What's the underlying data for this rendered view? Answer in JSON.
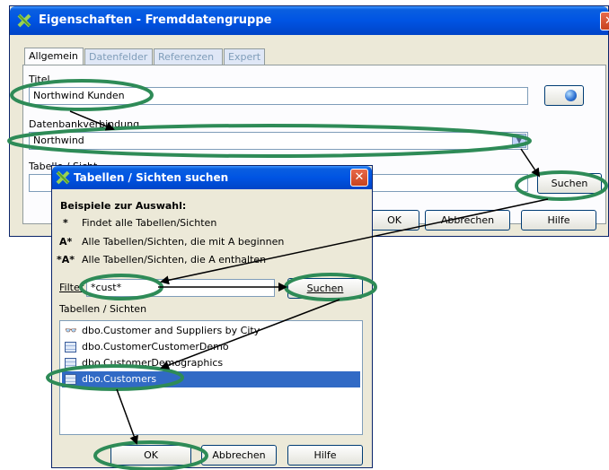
{
  "main_dialog": {
    "title": "Eigenschaften - Fremddatengruppe",
    "tabs": [
      {
        "label": "Allgemein",
        "active": true
      },
      {
        "label": "Datenfelder",
        "active": false
      },
      {
        "label": "Referenzen",
        "active": false
      },
      {
        "label": "Expert",
        "active": false
      }
    ],
    "titel_label": "Titel",
    "titel_value": "Northwind Kunden",
    "db_label": "Datenbankverbindung",
    "db_value": "Northwind",
    "table_label": "Tabelle / Sicht",
    "table_value": "",
    "suchen_label": "Suchen",
    "ok_label": "OK",
    "abbrechen_label": "Abbrechen",
    "hilfe_label": "Hilfe"
  },
  "search_dialog": {
    "title": "Tabellen / Sichten suchen",
    "examples_heading": "Beispiele zur Auswahl:",
    "examples": [
      {
        "symbol": "*",
        "text": "Findet alle Tabellen/Sichten"
      },
      {
        "symbol": "A*",
        "text": "Alle Tabellen/Sichten, die mit A beginnen"
      },
      {
        "symbol": "*A*",
        "text": "Alle Tabellen/Sichten, die A enthalten"
      }
    ],
    "filter_label": "Filter",
    "filter_value": "*cust*",
    "suchen_label": "Suchen",
    "list_label": "Tabellen / Sichten",
    "items": [
      {
        "name": "dbo.Customer and Suppliers by City",
        "kind": "view",
        "selected": false
      },
      {
        "name": "dbo.CustomerCustomerDemo",
        "kind": "table",
        "selected": false
      },
      {
        "name": "dbo.CustomerDemographics",
        "kind": "table",
        "selected": false
      },
      {
        "name": "dbo.Customers",
        "kind": "table",
        "selected": true
      }
    ],
    "ok_label": "OK",
    "abbrechen_label": "Abbrechen",
    "hilfe_label": "Hilfe"
  },
  "colors": {
    "annotation": "#2e8b57",
    "titlebar": "#0054e3",
    "selection": "#316ac5"
  }
}
